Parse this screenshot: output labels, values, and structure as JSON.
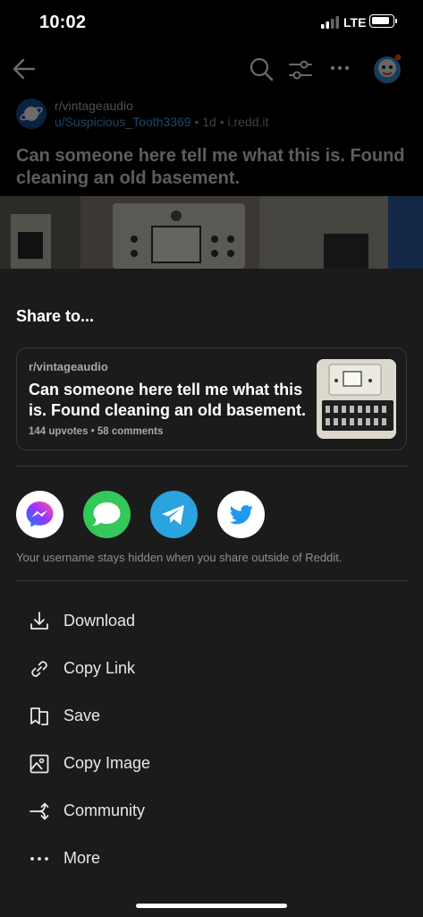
{
  "status": {
    "time": "10:02",
    "network": "LTE"
  },
  "post": {
    "subreddit": "r/vintageaudio",
    "username": "u/Suspicious_Tooth3369",
    "meta_suffix": " • 1d • i.redd.it",
    "title": "Can someone here tell me what this is. Found cleaning an old basement."
  },
  "share": {
    "heading": "Share to...",
    "card": {
      "subreddit": "r/vintageaudio",
      "title": "Can someone here tell me what this is. Found cleaning an old basement.",
      "stats": "144 upvotes • 58 comments"
    },
    "apps": [
      {
        "name": "Messenger",
        "icon": "messenger-icon",
        "color": "#ffffff"
      },
      {
        "name": "Messages",
        "icon": "messages-icon",
        "color": "#34c759"
      },
      {
        "name": "Telegram",
        "icon": "telegram-icon",
        "color": "#2aa3de"
      },
      {
        "name": "Twitter",
        "icon": "twitter-icon",
        "color": "#ffffff"
      }
    ],
    "privacy_note": "Your username stays hidden when you share outside of Reddit.",
    "actions": [
      {
        "label": "Download",
        "icon": "download-icon"
      },
      {
        "label": "Copy Link",
        "icon": "link-icon"
      },
      {
        "label": "Save",
        "icon": "bookmark-icon"
      },
      {
        "label": "Copy Image",
        "icon": "image-icon"
      },
      {
        "label": "Community",
        "icon": "crosspost-icon"
      },
      {
        "label": "More",
        "icon": "more-icon"
      }
    ]
  },
  "colors": {
    "sheet_bg": "#1b1b1b",
    "accent_link": "#4aa3ff"
  }
}
